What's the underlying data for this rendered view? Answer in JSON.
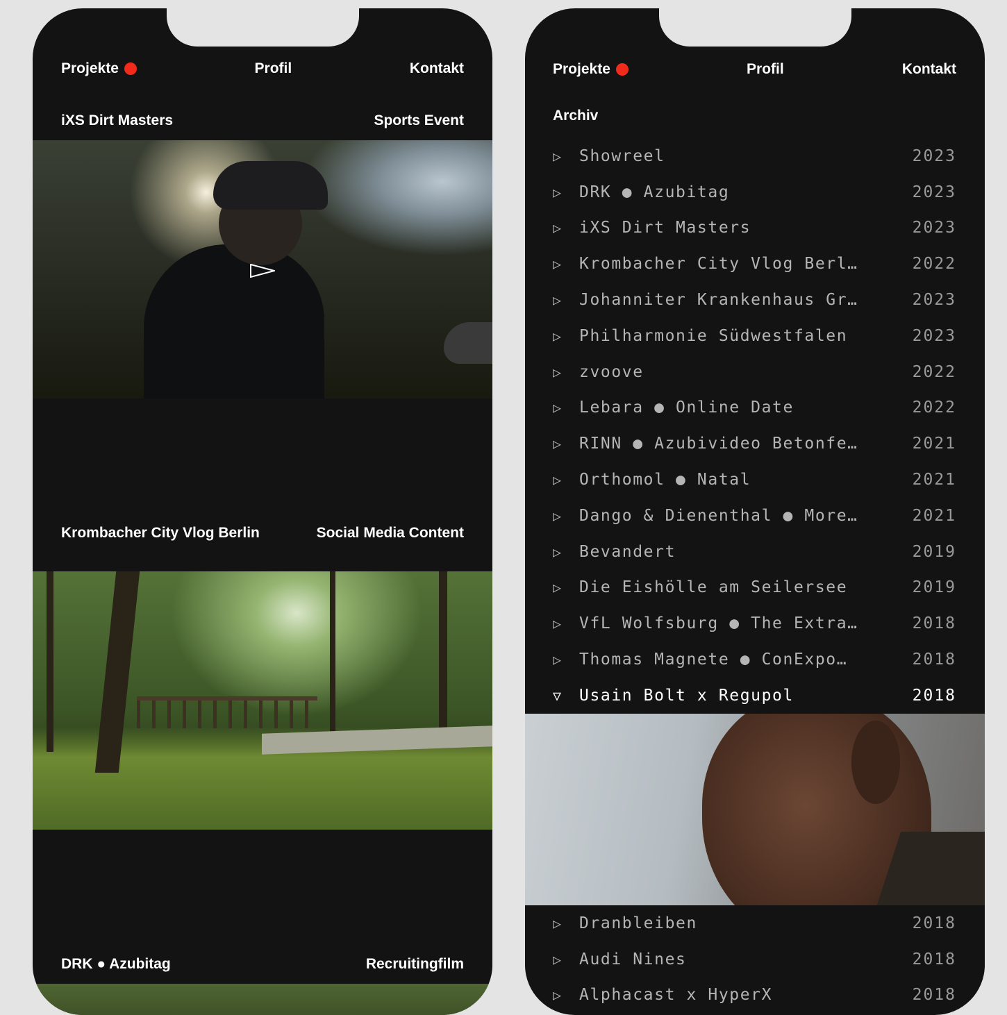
{
  "left_phone": {
    "nav": {
      "projects": "Projekte",
      "profile": "Profil",
      "contact": "Kontakt"
    },
    "cards": [
      {
        "title": "iXS Dirt Masters",
        "category": "Sports Event"
      },
      {
        "title": "Krombacher City Vlog Berlin",
        "category": "Social Media Content"
      },
      {
        "title": "DRK ● Azubitag",
        "category": "Recruitingfilm"
      }
    ]
  },
  "right_phone": {
    "nav": {
      "projects": "Projekte",
      "profile": "Profil",
      "contact": "Kontakt"
    },
    "archive_title": "Archiv",
    "archive": [
      {
        "title": "Showreel",
        "year": "2023"
      },
      {
        "title": "DRK ● Azubitag",
        "year": "2023"
      },
      {
        "title": "iXS Dirt Masters",
        "year": "2023"
      },
      {
        "title": "Krombacher City Vlog Berl…",
        "year": "2022"
      },
      {
        "title": "Johanniter Krankenhaus Gr…",
        "year": "2023"
      },
      {
        "title": "Philharmonie Südwestfalen",
        "year": "2023"
      },
      {
        "title": "zvoove",
        "year": "2022"
      },
      {
        "title": "Lebara ● Online Date",
        "year": "2022"
      },
      {
        "title": "RINN ● Azubivideo Betonfe…",
        "year": "2021"
      },
      {
        "title": "Orthomol ● Natal",
        "year": "2021"
      },
      {
        "title": "Dango & Dienenthal ● More…",
        "year": "2021"
      },
      {
        "title": "Bevandert",
        "year": "2019"
      },
      {
        "title": "Die Eishölle am Seilersee",
        "year": "2019"
      },
      {
        "title": "VfL Wolfsburg ● The Extra…",
        "year": "2018"
      },
      {
        "title": "Thomas Magnete ● ConExpo…",
        "year": "2018"
      },
      {
        "title": "Usain Bolt x Regupol",
        "year": "2018"
      }
    ],
    "archive_after": [
      {
        "title": "Dranbleiben",
        "year": "2018"
      },
      {
        "title": "Audi Nines",
        "year": "2018"
      },
      {
        "title": "Alphacast x HyperX",
        "year": "2018"
      }
    ],
    "icons": {
      "collapsed": "▷",
      "expanded": "▽"
    }
  },
  "colors": {
    "background": "#e4e4e4",
    "phone": "#131313",
    "accent_dot": "#f22a1b"
  }
}
